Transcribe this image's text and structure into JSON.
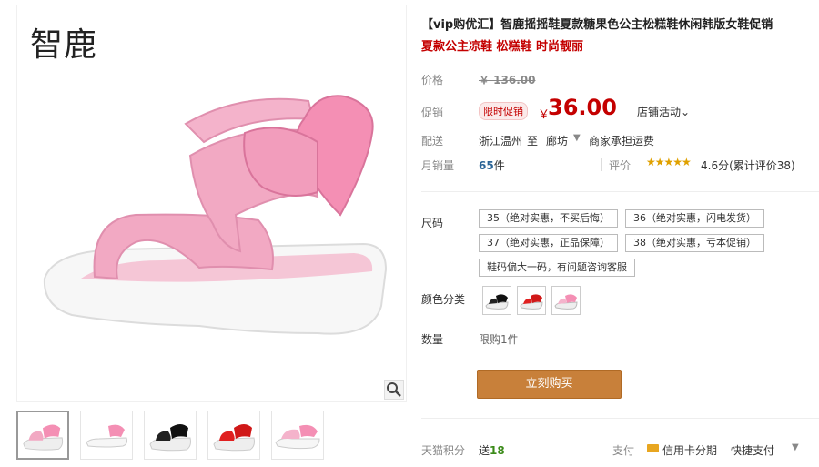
{
  "gallery": {
    "brand": "智鹿",
    "thumbnails": [
      "pink-sandal",
      "white-pink-sandal",
      "black-sandal",
      "red-sandal",
      "pink-sandal-side"
    ]
  },
  "product": {
    "title": "【vip购优汇】智鹿摇摇鞋夏款糖果色公主松糕鞋休闲韩版女鞋促销",
    "subtitle": "夏款公主凉鞋 松糕鞋 时尚靓丽",
    "labels": {
      "price": "价格",
      "promo": "促销",
      "shipping": "配送",
      "monthly_sales": "月销量",
      "rating": "评价",
      "size": "尺码",
      "color": "颜色分类",
      "quantity": "数量",
      "points": "天猫积分",
      "payment": "支付"
    },
    "original_price": "￥ 136.00",
    "promo_badge": "限时促销",
    "currency": "￥",
    "promo_price": "36.00",
    "shop_promo": "店铺活动⌄",
    "ship_from": "浙江温州",
    "ship_to_word": "至",
    "ship_to": "廊坊",
    "ship_fee": "商家承担运费",
    "sales_count": "65",
    "sales_unit": "件",
    "stars": "★★★★★",
    "rating_text": "4.6分(累计评价38)",
    "sizes": [
      "35（绝对实惠，不买后悔）",
      "36（绝对实惠，闪电发货）",
      "37（绝对实惠，正品保障）",
      "38（绝对实惠，亏本促销）",
      "鞋码偏大一码，有问题咨询客服"
    ],
    "colors": [
      "black",
      "red",
      "pink"
    ],
    "quantity_limit": "限购1件",
    "buy_button": "立刻购买",
    "points_prefix": "送",
    "points_value": "18",
    "card_payment": "信用卡分期",
    "quick_payment": "快捷支付",
    "more_caret": "▼",
    "caret": "▼"
  },
  "colors": {
    "price_red": "#c40000",
    "buy_button": "#c8803a",
    "points_green": "#3a8a18",
    "sales_blue": "#2a6496"
  }
}
